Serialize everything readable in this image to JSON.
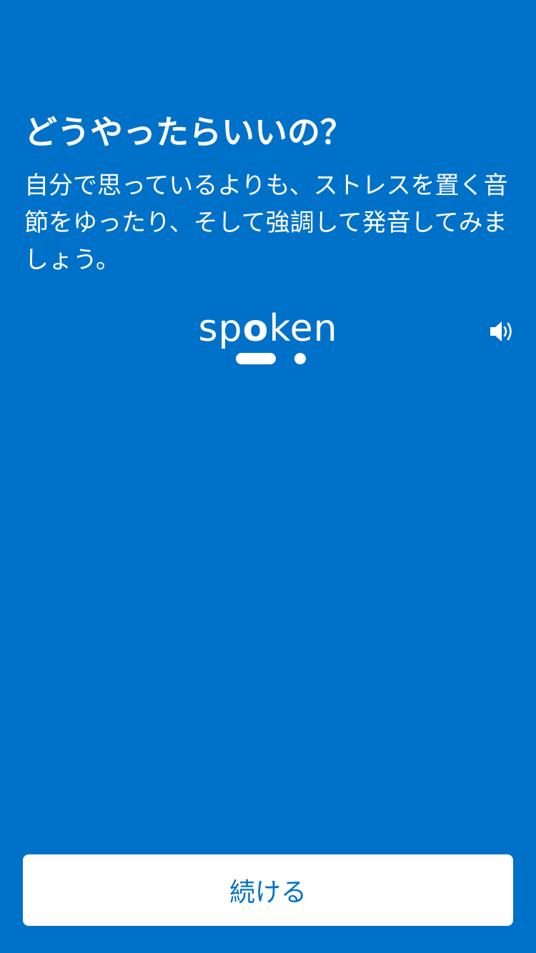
{
  "header": {
    "title": "どうやったらいいの？"
  },
  "instruction": {
    "text": "自分で思っているよりも、ストレスを置く音節をゆったり、そして強調して発音してみましょう。"
  },
  "word": {
    "before": "sp",
    "stressed": "o",
    "after": "ken",
    "syllable_pattern": [
      "long",
      "short"
    ]
  },
  "audio": {
    "icon": "speaker-icon"
  },
  "footer": {
    "continue_label": "続ける"
  },
  "colors": {
    "background": "#0071C9",
    "text": "#FFFFFF",
    "button_bg": "#FFFFFF",
    "button_text": "#0071C9"
  }
}
